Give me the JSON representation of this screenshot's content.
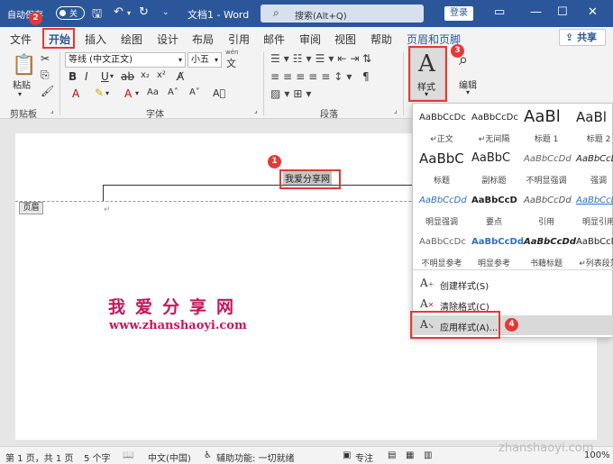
{
  "titlebar": {
    "autosave_label": "自动保存",
    "autosave_state": "关",
    "doc_title": "文档1 - Word",
    "search_placeholder": "搜索(Alt+Q)",
    "login_label": "登录"
  },
  "tabs": [
    "文件",
    "开始",
    "插入",
    "绘图",
    "设计",
    "布局",
    "引用",
    "邮件",
    "审阅",
    "视图",
    "帮助",
    "页眉和页脚"
  ],
  "share_label": "共享",
  "ribbon": {
    "clipboard": {
      "paste_label": "粘贴",
      "group_label": "剪贴板"
    },
    "font": {
      "font_name": "等线 (中文正文)",
      "font_size": "小五",
      "group_label": "字体",
      "wen_label": "wén",
      "wen_char": "文"
    },
    "paragraph": {
      "group_label": "段落"
    },
    "styles": {
      "label": "样式"
    },
    "editing": {
      "label": "编辑"
    }
  },
  "document": {
    "header_text": "我爱分享网",
    "header_tag": "页眉",
    "watermark_cn": "我爱分享网",
    "watermark_url": "www.zhanshaoyi.com"
  },
  "styles_gallery": {
    "cells": [
      {
        "sample": "AaBbCcDc",
        "name": "↵正文"
      },
      {
        "sample": "AaBbCcDc",
        "name": "↵无间隔"
      },
      {
        "sample": "AaBl",
        "name": "标题 1"
      },
      {
        "sample": "AaBl",
        "name": "标题 2"
      },
      {
        "sample": "AaBbC",
        "name": "标题"
      },
      {
        "sample": "AaBbC",
        "name": "副标题"
      },
      {
        "sample": "AaBbCcDd",
        "name": "不明显强调"
      },
      {
        "sample": "AaBbCcDd",
        "name": "强调"
      },
      {
        "sample": "AaBbCcDd",
        "name": "明显强调"
      },
      {
        "sample": "AaBbCcD",
        "name": "要点"
      },
      {
        "sample": "AaBbCcDd",
        "name": "引用"
      },
      {
        "sample": "AaBbCcDd",
        "name": "明显引用"
      },
      {
        "sample": "AaBbCcDc",
        "name": "不明显参考"
      },
      {
        "sample": "AaBbCcDd",
        "name": "明显参考"
      },
      {
        "sample": "AaBbCcDd",
        "name": "书籍标题"
      },
      {
        "sample": "AaBbCcDd",
        "name": "↵列表段落"
      }
    ],
    "actions": {
      "create": "创建样式(S)",
      "clear": "清除格式(C)",
      "apply": "应用样式(A)..."
    }
  },
  "annotations": [
    "1",
    "2",
    "3",
    "4"
  ],
  "statusbar": {
    "page": "第 1 页，共 1 页",
    "words": "5 个字",
    "lang": "中文(中国)",
    "accessibility": "辅助功能: 一切就绪",
    "focus": "专注",
    "zoom": "100%"
  },
  "site_watermark": "zhanshaoyi.com",
  "colors": {
    "brand": "#2b579a",
    "annotation": "#e53935",
    "watermark": "#c2185b"
  }
}
